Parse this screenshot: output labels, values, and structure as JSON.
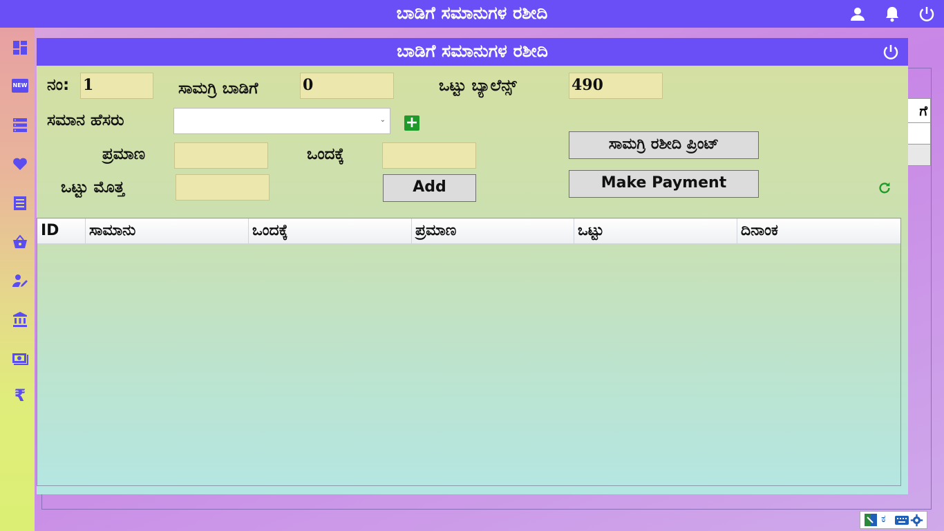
{
  "app": {
    "title": "ಬಾಡಿಗೆ ಸಮಾನುಗಳ ರಶೀದಿ"
  },
  "topbar_icons": [
    "user-icon",
    "bell-icon",
    "power-icon"
  ],
  "sidebar": {
    "items": [
      {
        "icon": "dashboard-icon"
      },
      {
        "icon": "new-badge-icon",
        "badge_text": "NEW"
      },
      {
        "icon": "list-icon"
      },
      {
        "icon": "heart-icon"
      },
      {
        "icon": "receipt-icon"
      },
      {
        "icon": "basket-icon"
      },
      {
        "icon": "edit-user-icon"
      },
      {
        "icon": "bank-icon"
      },
      {
        "icon": "cash-icon"
      },
      {
        "icon": "rupee-icon",
        "glyph": "₹"
      }
    ]
  },
  "background_table": {
    "header_fragment": "ಗೆ"
  },
  "dialog": {
    "title": "ಬಾಡಿಗೆ ಸಮಾನುಗಳ ರಶೀದಿ",
    "no_label": "ನಂ:",
    "no_value": "1",
    "rent_label": "ಸಾಮಗ್ರಿ ಬಾಡಿಗೆ",
    "rent_value": "0",
    "balance_label": "ಒಟ್ಟು ಬ್ಯಾಲೆನ್ಸ್",
    "balance_value": "490",
    "item_name_label": "ಸಮಾನ ಹೆಸರು",
    "item_name_value": "",
    "quantity_label": "ಪ್ರಮಾಣ",
    "quantity_value": "",
    "unit_price_label": "ಒಂದಕ್ಕೆ",
    "unit_price_value": "",
    "total_label": "ಒಟ್ಟು ಮೊತ್ತ",
    "total_value": "",
    "add_button": "Add",
    "print_button": "ಸಾಮಗ್ರಿ ರಶೀದಿ ಪ್ರಿಂಟ್",
    "payment_button": "Make Payment"
  },
  "table": {
    "columns": [
      "ID",
      "ಸಾಮಾನು",
      "ಒಂದಕ್ಕೆ",
      "ಪ್ರಮಾಣ",
      "ಒಟ್ಟು",
      "ದಿನಾಂಕ"
    ],
    "rows": []
  },
  "tray": {
    "ime_char": "ಕ"
  },
  "colors": {
    "header": "#6a4ff7",
    "field_bg": "#ebe7ad",
    "add_green": "#1f9a2a"
  }
}
